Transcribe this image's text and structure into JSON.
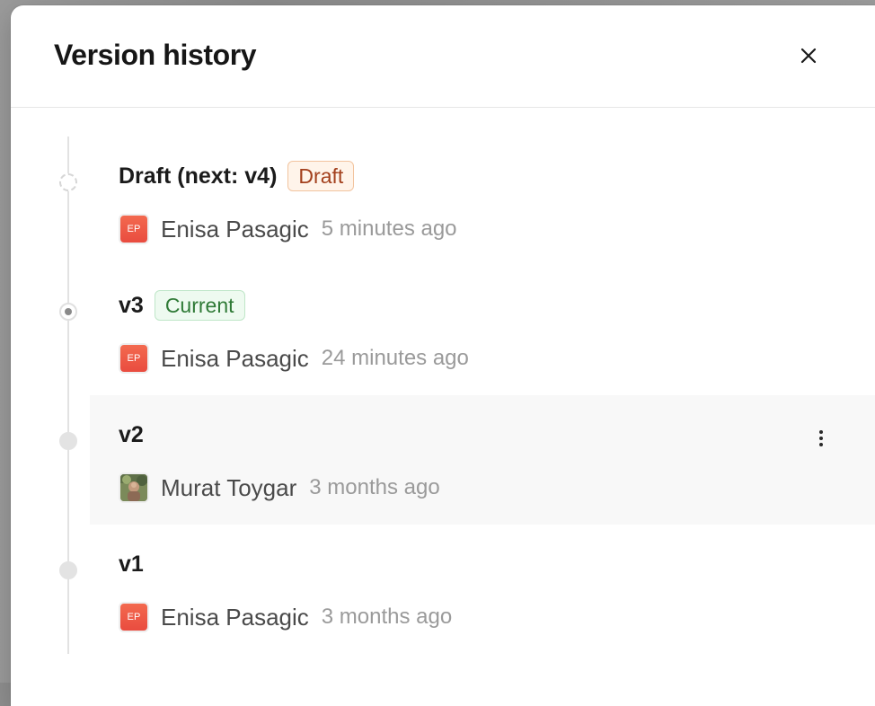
{
  "dialog": {
    "title": "Version history",
    "close_icon": "close-icon"
  },
  "versions": [
    {
      "name": "Draft (next: v4)",
      "badge": "Draft",
      "marker": "dashed",
      "author": "Enisa Pasagic",
      "avatar_initials": "EP",
      "time": "5 minutes ago"
    },
    {
      "name": "v3",
      "badge": "Current",
      "marker": "current",
      "author": "Enisa Pasagic",
      "avatar_initials": "EP",
      "time": "24 minutes ago"
    },
    {
      "name": "v2",
      "badge": "",
      "marker": "solid",
      "author": "Murat Toygar",
      "avatar_initials": "",
      "time": "3 months ago",
      "highlighted": true,
      "more_icon": "more-vertical-icon"
    },
    {
      "name": "v1",
      "badge": "",
      "marker": "solid",
      "author": "Enisa Pasagic",
      "avatar_initials": "EP",
      "time": "3 months ago"
    }
  ],
  "colors": {
    "draft_badge_text": "#a3401d",
    "draft_badge_bg": "#fff4ea",
    "current_badge_text": "#2f7a36",
    "current_badge_bg": "#eefaf0",
    "avatar_initials_bg": "#f36a4f"
  }
}
